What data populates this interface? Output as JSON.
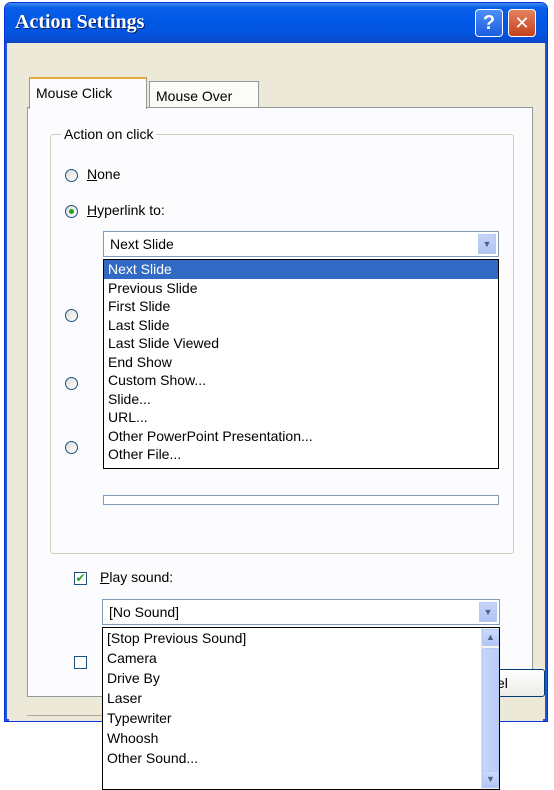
{
  "window": {
    "title": "Action Settings",
    "help_glyph": "?",
    "close_glyph": "✕"
  },
  "tabs": [
    {
      "label": "Mouse Click",
      "active": true
    },
    {
      "label": "Mouse Over",
      "active": false
    }
  ],
  "action_group": {
    "legend": "Action on click",
    "radios": [
      {
        "label_first": "N",
        "label_rest": "one",
        "checked": false
      },
      {
        "label_first": "H",
        "label_rest": "yperlink to:",
        "checked": true
      }
    ],
    "hyperlink_value": "Next Slide",
    "hyperlink_options": [
      "Next Slide",
      "Previous Slide",
      "First Slide",
      "Last Slide",
      "Last Slide Viewed",
      "End Show",
      "Custom Show...",
      "Slide...",
      "URL...",
      "Other PowerPoint Presentation...",
      "Other File..."
    ],
    "hyperlink_selected_index": 0
  },
  "sound": {
    "checkbox_checked": true,
    "label_first": "P",
    "label_rest": "lay sound:",
    "value": "[No Sound]",
    "options": [
      "[Stop Previous Sound]",
      "Camera",
      "Drive By",
      "Laser",
      "Typewriter",
      "Whoosh",
      "Other Sound..."
    ]
  },
  "cancel_button_partial": "cel",
  "icons": {
    "dropdown_arrow": "▼",
    "scroll_up": "▲",
    "scroll_down": "▼",
    "check": "✔"
  }
}
